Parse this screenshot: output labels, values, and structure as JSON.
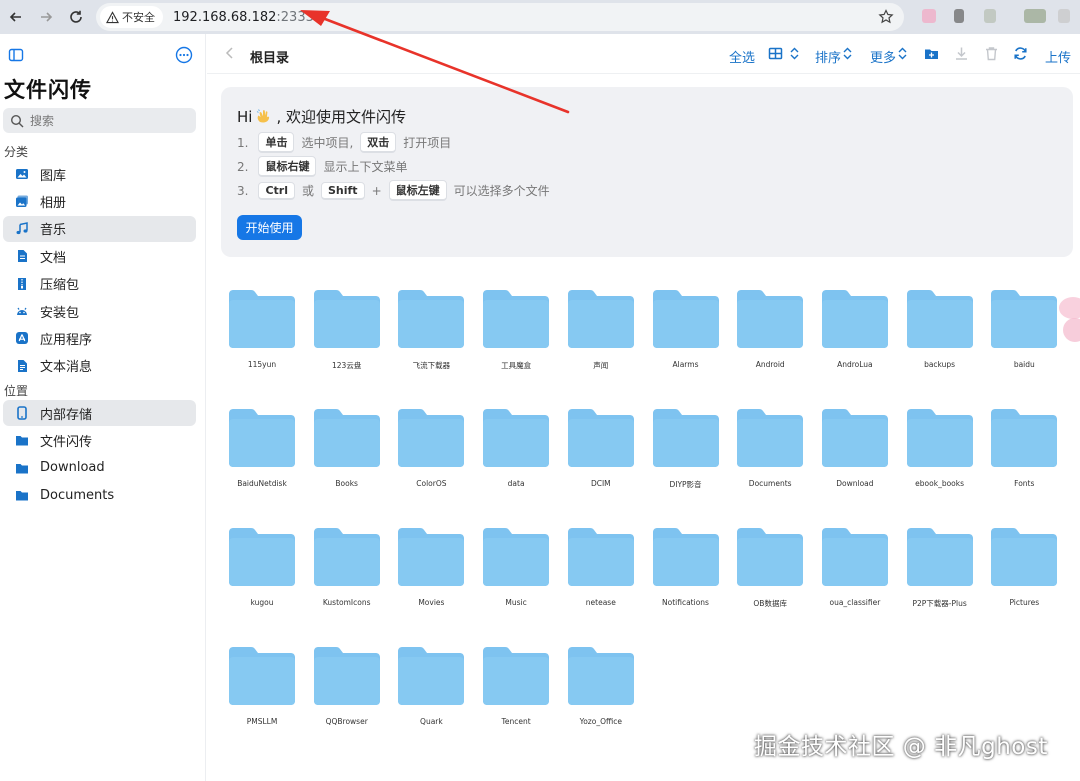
{
  "browser": {
    "security_label": "不安全",
    "url_host": "192.168.68.182",
    "url_port": ":2333"
  },
  "sidebar": {
    "app_title": "文件闪传",
    "search_placeholder": "搜索",
    "section_category": "分类",
    "categories": [
      {
        "label": "图库",
        "icon": "image-icon"
      },
      {
        "label": "相册",
        "icon": "album-icon"
      },
      {
        "label": "音乐",
        "icon": "music-icon",
        "active": true
      },
      {
        "label": "文档",
        "icon": "document-icon"
      },
      {
        "label": "压缩包",
        "icon": "archive-icon"
      },
      {
        "label": "安装包",
        "icon": "android-icon"
      },
      {
        "label": "应用程序",
        "icon": "app-store-icon"
      },
      {
        "label": "文本消息",
        "icon": "message-icon"
      }
    ],
    "section_location": "位置",
    "locations": [
      {
        "label": "内部存储",
        "icon": "phone-icon",
        "active": true
      },
      {
        "label": "文件闪传",
        "icon": "folder-icon"
      },
      {
        "label": "Download",
        "icon": "folder-icon"
      },
      {
        "label": "Documents",
        "icon": "folder-icon"
      }
    ]
  },
  "toolbar": {
    "crumb": "根目录",
    "select_all": "全选",
    "sort": "排序",
    "more": "更多",
    "upload": "上传"
  },
  "welcome": {
    "heading_pre": "Hi",
    "heading_post": ", 欢迎使用文件闪传",
    "row1": {
      "num": "1.",
      "k1": "单击",
      "t1": "选中项目,",
      "k2": "双击",
      "t2": "打开项目"
    },
    "row2": {
      "num": "2.",
      "k1": "鼠标右键",
      "t1": "显示上下文菜单"
    },
    "row3": {
      "num": "3.",
      "k1": "Ctrl",
      "t1": "或",
      "k2": "Shift",
      "t2": "+",
      "k3": "鼠标左键",
      "t3": "可以选择多个文件"
    },
    "start_button": "开始使用"
  },
  "folders": [
    "115yun",
    "123云盘",
    "飞流下载器",
    "工具魔盒",
    "声闻",
    "Alarms",
    "Android",
    "AndroLua",
    "backups",
    "baidu",
    "BaiduNetdisk",
    "Books",
    "ColorOS",
    "data",
    "DCIM",
    "DIYP影音",
    "Documents",
    "Download",
    "ebook_books",
    "Fonts",
    "kugou",
    "KustomIcons",
    "Movies",
    "Music",
    "netease",
    "Notifications",
    "OB数据库",
    "oua_classifier",
    "P2P下载器-Plus",
    "Pictures",
    "PMSLLM",
    "QQBrowser",
    "Quark",
    "Tencent",
    "Yozo_Office"
  ],
  "watermark": "掘金技术社区 @ 非凡ghost",
  "colors": {
    "accent": "#1677e6",
    "folder": "#7ec3f0",
    "arrow": "#e8332a"
  }
}
